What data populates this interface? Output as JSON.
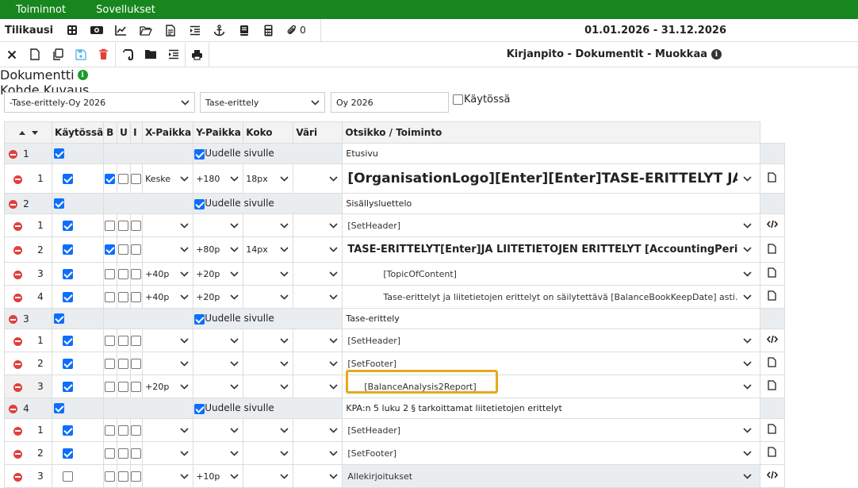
{
  "topbar": {
    "menu1": "Toiminnot",
    "menu2": "Sovellukset"
  },
  "toolbar1": {
    "title": "Tilikausi",
    "attach_count": "0",
    "period": "01.01.2026 - 31.12.2026",
    "icons": [
      "grid-icon",
      "money-icon",
      "chart-icon",
      "folder-open-icon",
      "document-icon",
      "indent-icon",
      "anchor-icon",
      "book-icon",
      "calculator-icon"
    ]
  },
  "toolbar2": {
    "page_title": "Kirjanpito - Dokumentit - Muokkaa",
    "icons": [
      "close-icon",
      "new-document-icon",
      "copy-icon",
      "save-icon",
      "delete-icon",
      "evernote-icon",
      "folder-icon",
      "indent-icon",
      "print-icon"
    ]
  },
  "form": {
    "dokumentti_label": "Dokumentti",
    "dokumentti_value": "-Tase-erittely-Oy 2026",
    "kohde_label": "Kohde",
    "kohde_value": "Tase-erittely",
    "kuvaus_label": "Kuvaus",
    "kuvaus_value": "Oy 2026",
    "kaytossa_label": "Käytössä"
  },
  "table": {
    "headers": {
      "kaytossa": "Käytössä",
      "b": "B",
      "u": "U",
      "i": "I",
      "x": "X-Paikka",
      "y": "Y-Paikka",
      "koko": "Koko",
      "vari": "Väri",
      "otsikko": "Otsikko / Toiminto"
    },
    "new_page_label": "Uudelle sivulle",
    "groups": [
      {
        "num": "1",
        "title": "Etusivu",
        "rows": [
          {
            "num": "1",
            "on": true,
            "b": true,
            "u": false,
            "i": false,
            "x": "Keske",
            "y": "+180",
            "koko": "18px",
            "text": "[OrganisationLogo][Enter][Enter]TASE-ERITTELYT JA [Ent",
            "style": "big",
            "action": "document-icon"
          }
        ]
      },
      {
        "num": "2",
        "title": "Sisällysluettelo",
        "rows": [
          {
            "num": "1",
            "on": true,
            "b": false,
            "u": false,
            "i": false,
            "x": "",
            "y": "",
            "koko": "",
            "text": "[SetHeader]",
            "style": "",
            "action": "code-icon"
          },
          {
            "num": "2",
            "on": true,
            "b": true,
            "u": false,
            "i": false,
            "x": "",
            "y": "+80p",
            "koko": "14px",
            "text": "TASE-ERITTELYT[Enter]JA LIITETIETOJEN ERITTELYT [AccountingPerioidEr",
            "style": "med",
            "action": "document-icon"
          },
          {
            "num": "3",
            "on": true,
            "b": false,
            "u": false,
            "i": false,
            "x": "+40p",
            "y": "+20p",
            "koko": "",
            "text": "[TopicOfContent]",
            "style": "ind",
            "action": "document-icon"
          },
          {
            "num": "4",
            "on": true,
            "b": false,
            "u": false,
            "i": false,
            "x": "+40p",
            "y": "+20p",
            "koko": "",
            "text": "Tase-erittelyt ja liitetietojen erittelyt on säilytettävä [BalanceBookKeepDate] asti.",
            "style": "ind",
            "action": "document-icon"
          }
        ]
      },
      {
        "num": "3",
        "title": "Tase-erittely",
        "rows": [
          {
            "num": "1",
            "on": true,
            "b": false,
            "u": false,
            "i": false,
            "x": "",
            "y": "",
            "koko": "",
            "text": "[SetHeader]",
            "style": "",
            "action": "code-icon"
          },
          {
            "num": "2",
            "on": true,
            "b": false,
            "u": false,
            "i": false,
            "x": "",
            "y": "",
            "koko": "",
            "text": "[SetFooter]",
            "style": "",
            "action": "document-icon"
          },
          {
            "num": "3",
            "on": true,
            "b": false,
            "u": false,
            "i": false,
            "x": "+20p",
            "y": "",
            "koko": "",
            "text": "[BalanceAnalysis2Report]",
            "style": "hlrow",
            "action": "document-icon"
          }
        ]
      },
      {
        "num": "4",
        "title": "KPA:n 5 luku 2 § tarkoittamat liitetietojen erittelyt",
        "rows": [
          {
            "num": "1",
            "on": true,
            "b": false,
            "u": false,
            "i": false,
            "x": "",
            "y": "",
            "koko": "",
            "text": "[SetHeader]",
            "style": "",
            "action": "document-icon"
          },
          {
            "num": "2",
            "on": true,
            "b": false,
            "u": false,
            "i": false,
            "x": "",
            "y": "",
            "koko": "",
            "text": "[SetFooter]",
            "style": "",
            "action": "document-icon"
          },
          {
            "num": "3",
            "on": false,
            "b": false,
            "u": false,
            "i": false,
            "x": "",
            "y": "+10p",
            "koko": "",
            "text": "Allekirjoitukset",
            "style": "gray",
            "action": "code-icon"
          }
        ]
      }
    ]
  }
}
